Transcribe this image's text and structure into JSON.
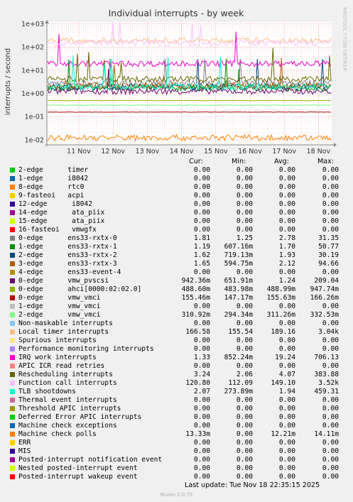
{
  "title": "Individual interrupts - by week",
  "ylabel": "interrupts / second",
  "watermark": "RRDTOOL / TOBI OETIKER",
  "footer": "Munin 2.0.75",
  "last_update": "Last update: Tue Nov 18 22:35:15 2025",
  "headers": {
    "cur": "Cur:",
    "min": "Min:",
    "avg": "Avg:",
    "max": "Max:"
  },
  "chart_data": {
    "type": "line",
    "y_scale": "log",
    "ylim": [
      0.006,
      1200
    ],
    "yticks": [
      "1e-02",
      "1e-01",
      "1e+00",
      "1e+01",
      "1e+02",
      "1e+03"
    ],
    "xticks": [
      "11 Nov",
      "12 Nov",
      "13 Nov",
      "14 Nov",
      "15 Nov",
      "16 Nov",
      "17 Nov",
      "18 Nov"
    ],
    "grid": true
  },
  "legend": [
    {
      "name": "2-edge      timer",
      "color": "#00cc00",
      "cur": "0.00",
      "min": "0.00",
      "avg": "0.00",
      "max": "0.00"
    },
    {
      "name": "1-edge      i8042",
      "color": "#0066b3",
      "cur": "0.00",
      "min": "0.00",
      "avg": "0.00",
      "max": "0.00"
    },
    {
      "name": "8-edge      rtc0",
      "color": "#ff8000",
      "cur": "0.00",
      "min": "0.00",
      "avg": "0.00",
      "max": "0.00"
    },
    {
      "name": "9-fasteoi   acpi",
      "color": "#ffcc00",
      "cur": "0.00",
      "min": "0.00",
      "avg": "0.00",
      "max": "0.00"
    },
    {
      "name": "12-edge      i8042",
      "color": "#330099",
      "cur": "0.00",
      "min": "0.00",
      "avg": "0.00",
      "max": "0.00"
    },
    {
      "name": "14-edge      ata_piix",
      "color": "#990099",
      "cur": "0.00",
      "min": "0.00",
      "avg": "0.00",
      "max": "0.00"
    },
    {
      "name": "15-edge      ata_piix",
      "color": "#ccff00",
      "cur": "0.00",
      "min": "0.00",
      "avg": "0.00",
      "max": "0.00"
    },
    {
      "name": "16-fasteoi   vmwgfx",
      "color": "#ff0000",
      "cur": "0.00",
      "min": "0.00",
      "avg": "0.00",
      "max": "0.00"
    },
    {
      "name": "0-edge      ens33-rxtx-0",
      "color": "#808080",
      "cur": "1.81",
      "min": "1.25",
      "avg": "2.78",
      "max": "31.35"
    },
    {
      "name": "1-edge      ens33-rxtx-1",
      "color": "#008f00",
      "cur": "1.19",
      "min": "607.16m",
      "avg": "1.70",
      "max": "50.77"
    },
    {
      "name": "2-edge      ens33-rxtx-2",
      "color": "#00487d",
      "cur": "1.62",
      "min": "719.13m",
      "avg": "1.93",
      "max": "30.19"
    },
    {
      "name": "3-edge      ens33-rxtx-3",
      "color": "#b35a00",
      "cur": "1.65",
      "min": "594.75m",
      "avg": "2.12",
      "max": "94.66"
    },
    {
      "name": "4-edge      ens33-event-4",
      "color": "#b38f00",
      "cur": "0.00",
      "min": "0.00",
      "avg": "0.00",
      "max": "0.00"
    },
    {
      "name": "0-edge      vmw_pvscsi",
      "color": "#6b006b",
      "cur": "942.36m",
      "min": "651.91m",
      "avg": "1.24",
      "max": "209.04"
    },
    {
      "name": "0-edge      ahci[0000:02:02.0]",
      "color": "#8fb300",
      "cur": "488.60m",
      "min": "483.98m",
      "avg": "488.99m",
      "max": "947.74m"
    },
    {
      "name": "0-edge      vmw_vmci",
      "color": "#b30000",
      "cur": "155.46m",
      "min": "147.17m",
      "avg": "155.63m",
      "max": "166.26m"
    },
    {
      "name": "1-edge      vmw_vmci",
      "color": "#bebebe",
      "cur": "0.00",
      "min": "0.00",
      "avg": "0.00",
      "max": "0.00"
    },
    {
      "name": "2-edge      vmw_vmci",
      "color": "#80ff80",
      "cur": "310.92m",
      "min": "294.34m",
      "avg": "311.26m",
      "max": "332.53m"
    },
    {
      "name": "Non-maskable interrupts",
      "color": "#80c9ff",
      "cur": "0.00",
      "min": "0.00",
      "avg": "0.00",
      "max": "0.00"
    },
    {
      "name": "Local timer interrupts",
      "color": "#ffc080",
      "cur": "166.58",
      "min": "155.54",
      "avg": "189.16",
      "max": "3.04k"
    },
    {
      "name": "Spurious interrupts",
      "color": "#ffe680",
      "cur": "0.00",
      "min": "0.00",
      "avg": "0.00",
      "max": "0.00"
    },
    {
      "name": "Performance monitoring interrupts",
      "color": "#aa80ff",
      "cur": "0.00",
      "min": "0.00",
      "avg": "0.00",
      "max": "0.00"
    },
    {
      "name": "IRQ work interrupts",
      "color": "#ee00cc",
      "cur": "1.33",
      "min": "852.24m",
      "avg": "19.24",
      "max": "706.13"
    },
    {
      "name": "APIC ICR read retries",
      "color": "#ff8080",
      "cur": "0.00",
      "min": "0.00",
      "avg": "0.00",
      "max": "0.00"
    },
    {
      "name": "Rescheduling interrupts",
      "color": "#666600",
      "cur": "3.24",
      "min": "2.06",
      "avg": "4.07",
      "max": "383.88"
    },
    {
      "name": "Function call interrupts",
      "color": "#ffbfff",
      "cur": "120.80",
      "min": "112.09",
      "avg": "149.10",
      "max": "3.52k"
    },
    {
      "name": "TLB shootdowns",
      "color": "#00ffcc",
      "cur": "2.07",
      "min": "273.89m",
      "avg": "1.94",
      "max": "459.31"
    },
    {
      "name": "Thermal event interrupts",
      "color": "#cc6699",
      "cur": "0.00",
      "min": "0.00",
      "avg": "0.00",
      "max": "0.00"
    },
    {
      "name": "Threshold APIC interrupts",
      "color": "#999900",
      "cur": "0.00",
      "min": "0.00",
      "avg": "0.00",
      "max": "0.00"
    },
    {
      "name": "Deferred Error APIC interrupts",
      "color": "#00cc00",
      "cur": "0.00",
      "min": "0.00",
      "avg": "0.00",
      "max": "0.00"
    },
    {
      "name": "Machine check exceptions",
      "color": "#0066b3",
      "cur": "0.00",
      "min": "0.00",
      "avg": "0.00",
      "max": "0.00"
    },
    {
      "name": "Machine check polls",
      "color": "#ff8000",
      "cur": "13.33m",
      "min": "0.00",
      "avg": "12.21m",
      "max": "14.11m"
    },
    {
      "name": "ERR",
      "color": "#ffcc00",
      "cur": "0.00",
      "min": "0.00",
      "avg": "0.00",
      "max": "0.00"
    },
    {
      "name": "MIS",
      "color": "#330099",
      "cur": "0.00",
      "min": "0.00",
      "avg": "0.00",
      "max": "0.00"
    },
    {
      "name": "Posted-interrupt notification event",
      "color": "#990099",
      "cur": "0.00",
      "min": "0.00",
      "avg": "0.00",
      "max": "0.00"
    },
    {
      "name": "Nested posted-interrupt event",
      "color": "#ccff00",
      "cur": "0.00",
      "min": "0.00",
      "avg": "0.00",
      "max": "0.00"
    },
    {
      "name": "Posted-interrupt wakeup event",
      "color": "#ff0000",
      "cur": "0.00",
      "min": "0.00",
      "avg": "0.00",
      "max": "0.00"
    }
  ]
}
